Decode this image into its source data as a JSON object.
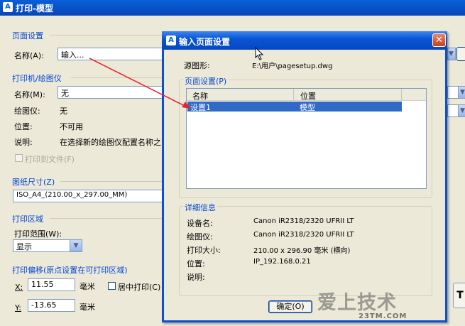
{
  "window": {
    "title": "打印-模型"
  },
  "page_setup": {
    "group_title": "页面设置",
    "name_label": "名称(A):",
    "name_value": "输入..."
  },
  "printer": {
    "group_title": "打印机/绘图仪",
    "name_label": "名称(M):",
    "name_value": "无",
    "plotter_label": "绘图仪:",
    "plotter_value": "无",
    "location_label": "位置:",
    "location_value": "不可用",
    "desc_label": "说明:",
    "desc_value": "在选择新的绘图仪配置名称之",
    "print_to_file": "打印到文件(F)"
  },
  "paper": {
    "group_title": "图纸尺寸(Z)",
    "value": "ISO_A4_(210.00_x_297.00_MM)"
  },
  "plot_area": {
    "group_title": "打印区域",
    "range_label": "打印范围(W):",
    "range_value": "显示"
  },
  "offset": {
    "group_title": "打印偏移(原点设置在可打印区域)",
    "x_label": "X:",
    "x_value": "11.55",
    "x_unit": "毫米",
    "y_label": "Y:",
    "y_value": "-13.65",
    "y_unit": "毫米",
    "center_label": "居中打印(C)"
  },
  "dialog": {
    "title": "输入页面设置",
    "source_label": "源图形:",
    "source_value": "E:\\用户\\pagesetup.dwg",
    "pagesetups_title": "页面设置(P)",
    "columns": [
      "名称",
      "位置"
    ],
    "rows": [
      {
        "name": "设置1",
        "location": "模型"
      }
    ],
    "details_title": "详细信息",
    "details": [
      {
        "label": "设备名:",
        "value": "Canon iR2318/2320 UFRII LT"
      },
      {
        "label": "绘图仪:",
        "value": "Canon iR2318/2320 UFRII LT"
      },
      {
        "label": "打印大小:",
        "value": "210.00 x 296.90 毫米 (横向)"
      },
      {
        "label": "位置:",
        "value": "IP_192.168.0.21"
      },
      {
        "label": "说明:",
        "value": ""
      }
    ],
    "ok_label": "确定(O)"
  },
  "watermark": {
    "text": "爱上技术",
    "url": "23TM.COM"
  },
  "colors": {
    "accent": "#0A5FD8",
    "selection": "#316AC5",
    "annotation": "#E8232A"
  }
}
